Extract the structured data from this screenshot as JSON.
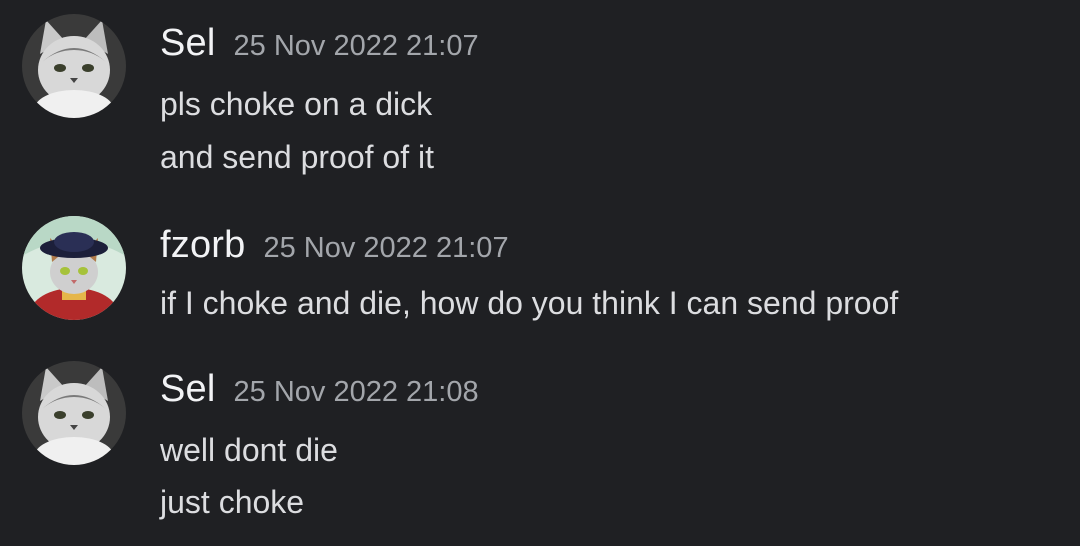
{
  "messages": [
    {
      "username": "Sel",
      "timestamp": "25 Nov 2022 21:07",
      "avatar_icon": "gray-cat-avatar-icon",
      "lines": [
        "pls choke on a dick",
        "and send proof of it"
      ]
    },
    {
      "username": "fzorb",
      "timestamp": "25 Nov 2022 21:07",
      "avatar_icon": "cat-in-hat-avatar-icon",
      "lines": [
        "if I choke and die, how do you think I can send proof"
      ]
    },
    {
      "username": "Sel",
      "timestamp": "25 Nov 2022 21:08",
      "avatar_icon": "gray-cat-avatar-icon",
      "lines": [
        "well dont die",
        "just choke"
      ]
    }
  ],
  "colors": {
    "background": "#1f2023",
    "username": "#f2f3f5",
    "timestamp": "#a3a6ab",
    "message_text": "#dcdde0"
  }
}
